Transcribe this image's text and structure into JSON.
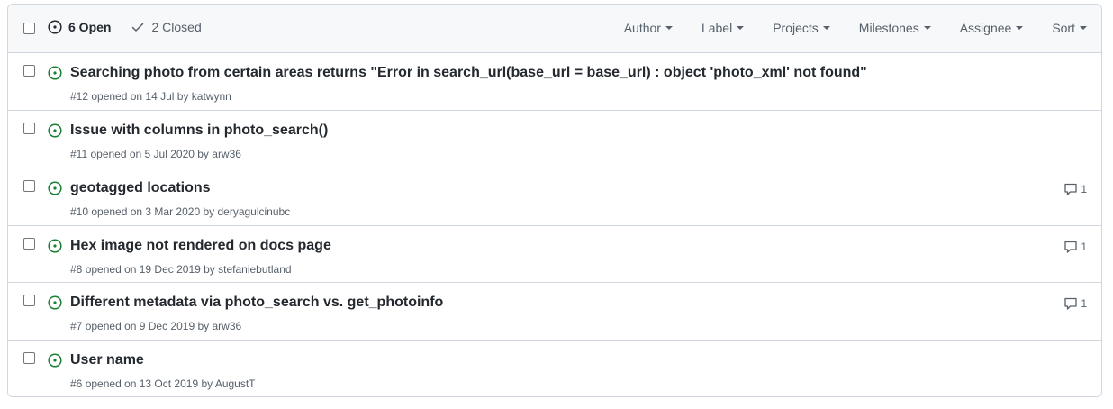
{
  "header": {
    "open_label": "6 Open",
    "closed_label": "2 Closed",
    "filters": [
      {
        "label": "Author"
      },
      {
        "label": "Label"
      },
      {
        "label": "Projects"
      },
      {
        "label": "Milestones"
      },
      {
        "label": "Assignee"
      },
      {
        "label": "Sort"
      }
    ]
  },
  "issues": [
    {
      "title": "Searching photo from certain areas returns \"Error in search_url(base_url = base_url) : object 'photo_xml' not found\"",
      "number": "#12",
      "opened": " opened on 14 Jul by ",
      "author": "katwynn",
      "comments": ""
    },
    {
      "title": "Issue with columns in photo_search()",
      "number": "#11",
      "opened": " opened on 5 Jul 2020 by ",
      "author": "arw36",
      "comments": ""
    },
    {
      "title": "geotagged locations",
      "number": "#10",
      "opened": " opened on 3 Mar 2020 by ",
      "author": "deryagulcinubc",
      "comments": "1"
    },
    {
      "title": "Hex image not rendered on docs page",
      "number": "#8",
      "opened": " opened on 19 Dec 2019 by ",
      "author": "stefaniebutland",
      "comments": "1"
    },
    {
      "title": "Different metadata via photo_search vs. get_photoinfo",
      "number": "#7",
      "opened": " opened on 9 Dec 2019 by ",
      "author": "arw36",
      "comments": "1"
    },
    {
      "title": "User name",
      "number": "#6",
      "opened": " opened on 13 Oct 2019 by ",
      "author": "AugustT",
      "comments": ""
    }
  ],
  "colors": {
    "open_green": "#1a7f37",
    "muted": "#57606a",
    "border": "#d0d7de"
  }
}
